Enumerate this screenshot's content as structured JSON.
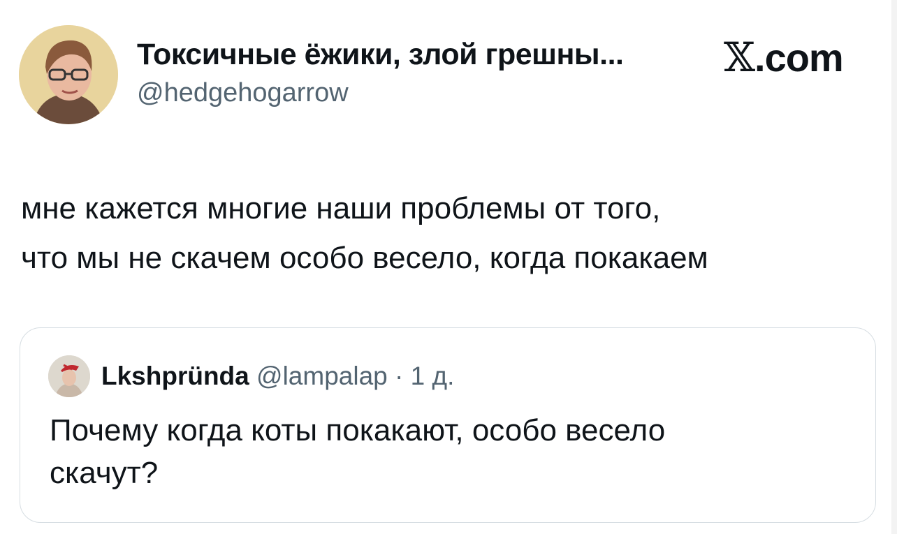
{
  "author": {
    "display_name": "Токсичные ёжики, злой грешны...",
    "handle": "@hedgehogarrow"
  },
  "brand": {
    "x_glyph": "𝕏",
    "suffix": ".com"
  },
  "tweet": {
    "line1": "мне кажется многие наши проблемы от того,",
    "line2": "что мы не скачем особо весело, когда покакаем"
  },
  "quote": {
    "display_name": "Lkshpründa",
    "handle": "@lampalap",
    "separator": " · ",
    "time": "1 д.",
    "line1": "Почему когда коты покакают, особо весело",
    "line2": "скачут?"
  },
  "colors": {
    "text": "#0f1419",
    "secondary": "#536471",
    "border": "#d6dde2"
  }
}
